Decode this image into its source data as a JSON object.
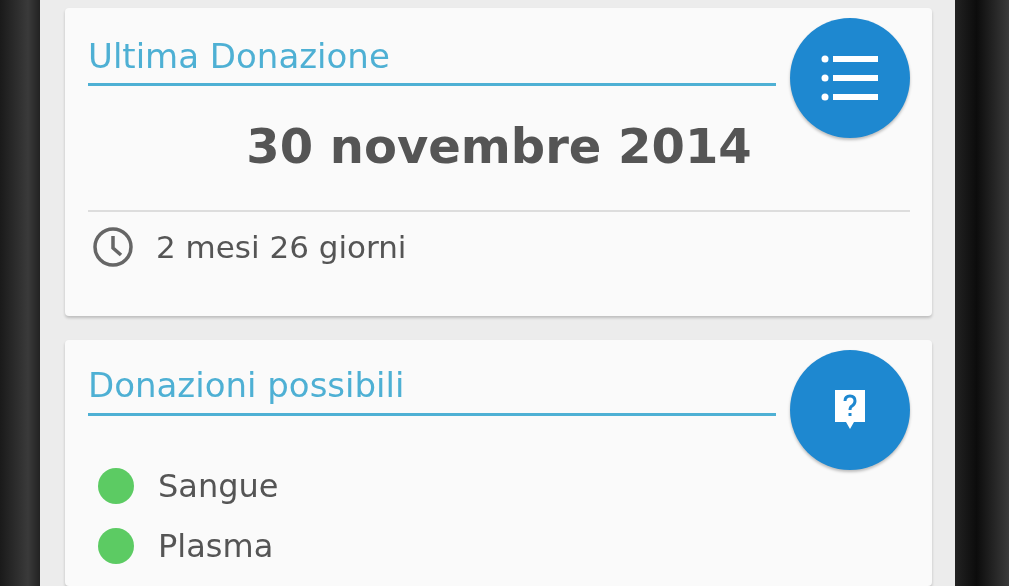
{
  "last_donation": {
    "title": "Ultima Donazione",
    "date": "30 novembre 2014",
    "elapsed": "2 mesi 26 giorni"
  },
  "possible_donations": {
    "title": "Donazioni possibili",
    "items": [
      {
        "label": "Sangue",
        "color": "#5ccb63"
      },
      {
        "label": "Plasma",
        "color": "#5ccb63"
      }
    ]
  }
}
